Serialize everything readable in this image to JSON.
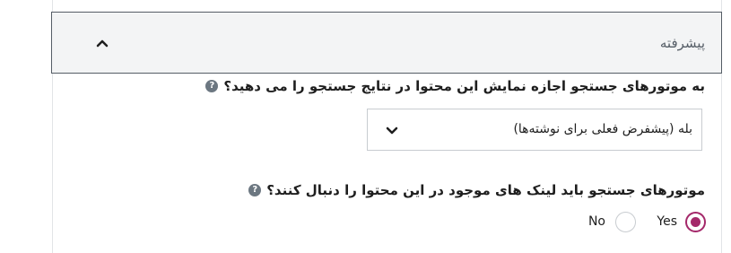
{
  "advanced_section": {
    "title": "پیشرفته",
    "toggle_icon": "chevron-up-icon",
    "expanded": true
  },
  "search_visibility": {
    "question": "به موتورهای جستجو اجازه نمایش این محتوا در نتایج جستجو را می دهید؟",
    "help_icon": "question-mark-icon",
    "select_value": "بله (پیشفرض فعلی برای نوشته‌ها)",
    "dropdown_icon": "chevron-down-icon"
  },
  "follow_links": {
    "question": "موتورهای جستجو باید لینک های موجود در این محتوا را دنبال کنند؟",
    "help_icon": "question-mark-icon",
    "options": [
      {
        "label": "Yes",
        "checked": true
      },
      {
        "label": "No",
        "checked": false
      }
    ],
    "accent_color": "#a4286a"
  }
}
